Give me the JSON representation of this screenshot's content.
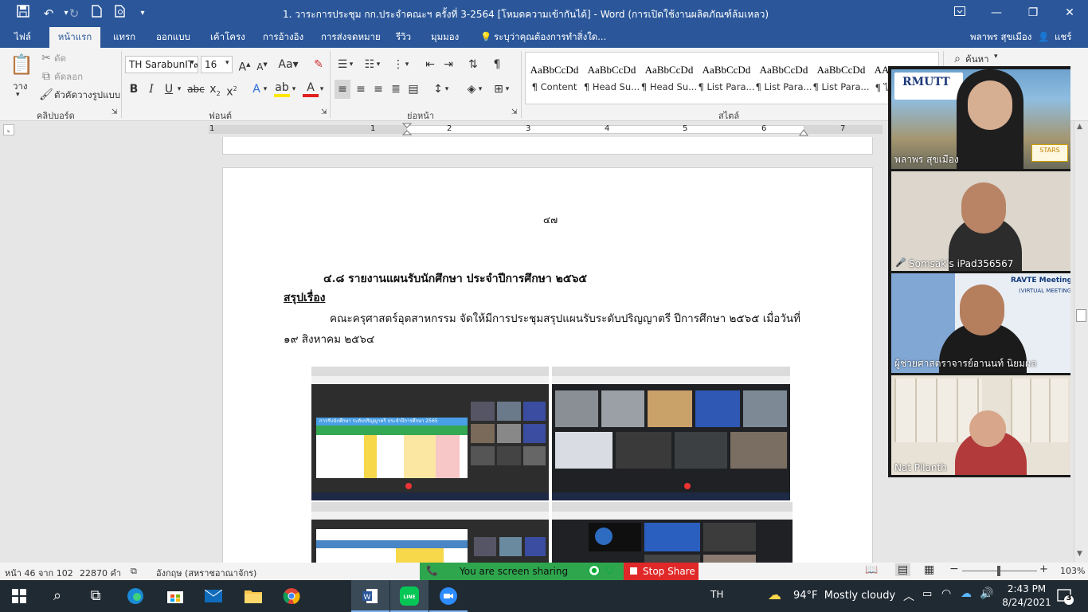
{
  "window": {
    "title": "1. วาระการประชุม กก.ประจำคณะฯ ครั้งที่ 3-2564 [โหมดความเข้ากันได้] - Word (การเปิดใช้งานผลิตภัณฑ์ล้มเหลว)",
    "quick_access": [
      "save-icon",
      "undo-icon",
      "redo-icon",
      "new-doc-icon",
      "print-preview-icon",
      "customize-icon"
    ]
  },
  "tabs": {
    "items": [
      "ไฟล์",
      "หน้าแรก",
      "แทรก",
      "ออกแบบ",
      "เค้าโครง",
      "การอ้างอิง",
      "การส่งจดหมาย",
      "รีวิว",
      "มุมมอง"
    ],
    "tell_me": "ระบุว่าคุณต้องการทำสิ่งใด...",
    "user_name": "พลาพร สุขเมือง",
    "share": "แชร์"
  },
  "ribbon": {
    "clipboard": {
      "paste": "วาง",
      "cut": "ตัด",
      "copy": "คัดลอก",
      "format_painter": "ตัวคัดวางรูปแบบ",
      "group_label": "คลิปบอร์ด"
    },
    "font": {
      "name": "TH SarabunIT๙",
      "size": "16",
      "group_label": "ฟอนต์"
    },
    "paragraph": {
      "group_label": "ย่อหน้า"
    },
    "styles": {
      "items": [
        {
          "preview": "AaBbCcDd",
          "name": "¶ Content"
        },
        {
          "preview": "AaBbCcDd",
          "name": "¶ Head Su..."
        },
        {
          "preview": "AaBbCcDd",
          "name": "¶ Head Su..."
        },
        {
          "preview": "AaBbCcDd",
          "name": "¶ List Para..."
        },
        {
          "preview": "AaBbCcDd",
          "name": "¶ List Para..."
        },
        {
          "preview": "AaBbCcDd",
          "name": "¶ List Para..."
        },
        {
          "preview": "AA",
          "name": "¶ ไ"
        }
      ],
      "group_label": "สไตล์"
    },
    "editing": {
      "find": "ค้นหา"
    }
  },
  "ruler": {
    "numbers": [
      "1",
      "1",
      "2",
      "3",
      "4",
      "5",
      "6",
      "7"
    ]
  },
  "document": {
    "page_number": "๔๗",
    "heading": "๔.๘ รายงานแผนรับนักศึกษา ประจำปีการศึกษา ๒๕๖๕",
    "summary_label": "สรุปเรื่อง",
    "body_line1": "คณะครุศาสตร์อุตสาหกรรม จัดให้มีการประชุมสรุปแผนรับระดับปริญญาตรี  ปีการศึกษา ๒๕๖๕  เมื่อวันที่",
    "body_line2": "๑๙ สิงหาคม ๒๕๖๔",
    "screenshot_table_title": "การรับนักศึกษา  ระดับปริญญาตรี ประจำปีการศึกษา 2565"
  },
  "zoom": {
    "participants": [
      {
        "name": "พลาพร สุขเมือง",
        "banner": "RMUTT",
        "badge": "STARS"
      },
      {
        "name": "Somsak's iPad356567"
      },
      {
        "name": "ผู้ช่วยศาสตราจารย์อานนท์ นิยมผล",
        "banner": "RAVTE Meeting",
        "sub": "(VIRTUAL MEETING)"
      },
      {
        "name": "Nat Pilanth"
      }
    ],
    "sharing_text": "You are screen sharing",
    "stop_share": "Stop Share"
  },
  "statusbar": {
    "page": "หน้า 46 จาก 102",
    "words": "22870 คำ",
    "language": "อังกฤษ (สหราชอาณาจักร)",
    "zoom_percent": "103%"
  },
  "taskbar": {
    "lang": "TH",
    "weather": "94°F  Mostly cloudy",
    "time": "2:43 PM",
    "date": "8/24/2021",
    "notifications": "3"
  },
  "colors": {
    "word_blue": "#2b579a",
    "zoom_green": "#2ea64d",
    "stop_red": "#e02828",
    "taskbar": "#1f2a33"
  }
}
